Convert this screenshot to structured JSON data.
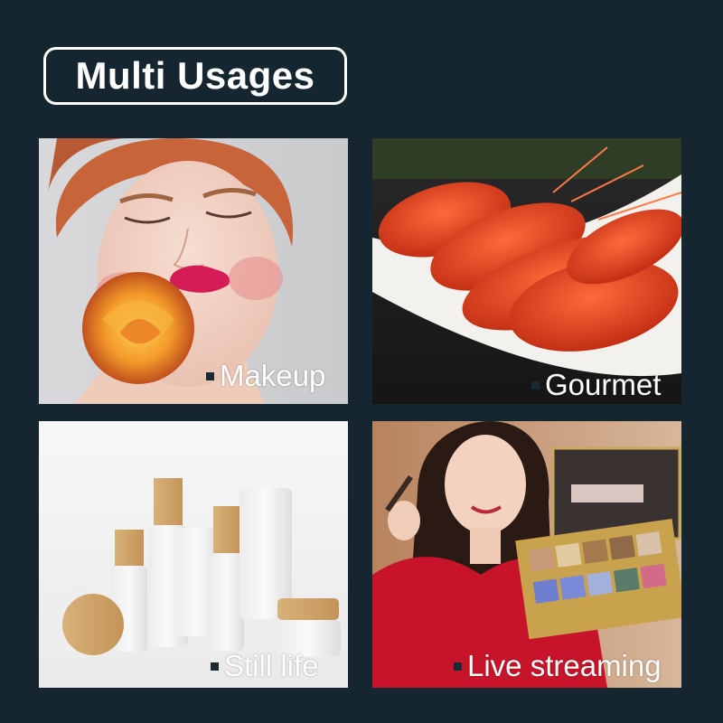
{
  "title": "Multi Usages",
  "tiles": {
    "makeup": {
      "caption": "Makeup"
    },
    "gourmet": {
      "caption": "Gourmet"
    },
    "still_life": {
      "caption": "Still life"
    },
    "live_streaming": {
      "caption": "Live streaming"
    }
  },
  "colors": {
    "background": "#162630",
    "title_border": "#ffffff",
    "caption_text": "#ffffff"
  }
}
